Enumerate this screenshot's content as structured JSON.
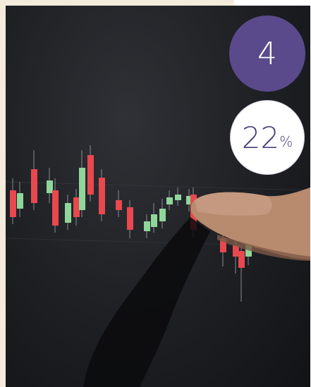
{
  "badges": {
    "count": "4",
    "percent_value": "22",
    "percent_unit": "%"
  },
  "colors": {
    "badge_purple": "#5a4a8c",
    "candle_up": "#8fd69a",
    "candle_down": "#e8484e",
    "background": "#f3ecdc"
  },
  "scene": {
    "icon": "hand-pointing-at-candlestick-chart"
  }
}
